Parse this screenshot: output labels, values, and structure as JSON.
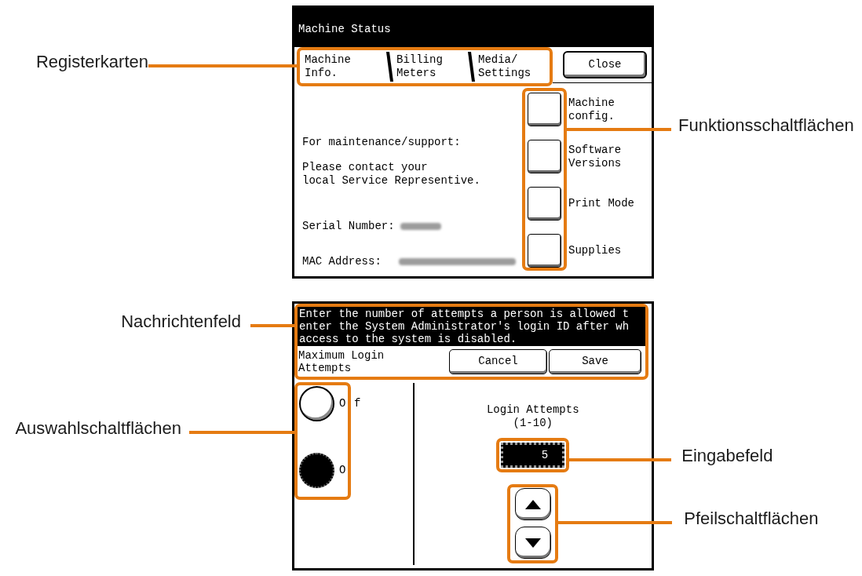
{
  "machine_status_screen": {
    "title": "Machine Status",
    "tabs": {
      "callout": "Registerkarten",
      "items": [
        {
          "label": "Machine Info.",
          "selected": true
        },
        {
          "label": "Billing Meters",
          "selected": false
        },
        {
          "label": "Media/ Settings",
          "selected": false
        }
      ]
    },
    "close_button": "Close",
    "support_note": "For maintenance/support:",
    "contact_lines": [
      "Please contact your",
      "local Service Representive."
    ],
    "serial_number": {
      "label": "Serial Number:",
      "value_blurred": true
    },
    "mac_address": {
      "label": "MAC Address:",
      "value_blurred": true
    },
    "function_buttons": {
      "callout": "Funktionsschaltflächen",
      "items": [
        {
          "label": "Machine config."
        },
        {
          "label": "Software Versions"
        },
        {
          "label": "Print Mode"
        },
        {
          "label": "Supplies"
        }
      ]
    }
  },
  "login_attempts_screen": {
    "message": {
      "callout": "Nachrichtenfeld",
      "lines": [
        "Enter the number of attempts a person is allowed t",
        "enter the System Administrator's login ID after wh",
        "access to the system is disabled."
      ]
    },
    "setting_name": "Maximum Login Attempts",
    "buttons": [
      "Cancel",
      "Save"
    ],
    "options": {
      "callout": "Auswahlschaltflächen",
      "items": [
        {
          "label_parts": [
            "O",
            "f"
          ],
          "selected": false
        },
        {
          "label_parts": [
            "O"
          ],
          "selected": true
        }
      ]
    },
    "value_label": "Login Attempts",
    "range": "(1-10)",
    "input": {
      "callout": "Eingabefeld",
      "value": "5"
    },
    "arrow_buttons": {
      "callout": "Pfeilschaltflächen",
      "items": [
        {
          "kind": "up"
        },
        {
          "kind": "down"
        }
      ]
    }
  }
}
